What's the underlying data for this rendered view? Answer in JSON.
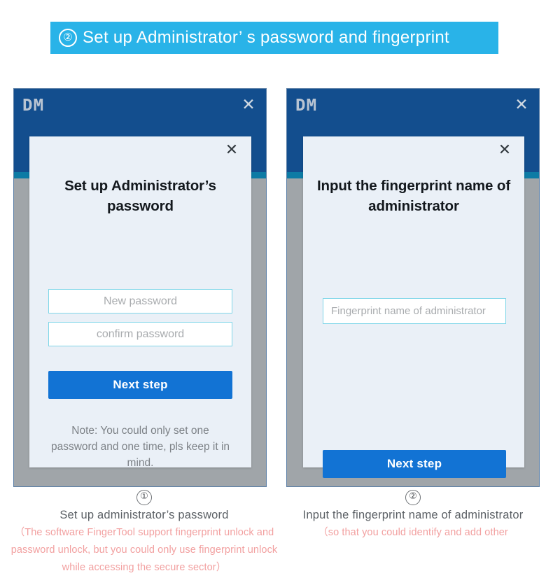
{
  "banner": {
    "number": "②",
    "text": "Set up  Administrator’  s  password and fingerprint",
    "bg_color": "#29b3e8"
  },
  "windows": [
    {
      "id": "password-window",
      "logo": "DM",
      "titlebar_close": "✕",
      "titlebar_color": "#134e8e",
      "accent_color": "#0d7ba5",
      "dialog": {
        "close": "✕",
        "title": "Set up  Administrator’s password",
        "fields": [
          {
            "name": "new-password",
            "placeholder": "New password",
            "value": ""
          },
          {
            "name": "confirm-password",
            "placeholder": "confirm password",
            "value": ""
          }
        ],
        "button": "Next step",
        "button_color": "#1273d4",
        "note": "Note: You could only set one password and one time, pls keep it in mind."
      }
    },
    {
      "id": "fingerprint-window",
      "logo": "DM",
      "titlebar_close": "✕",
      "titlebar_color": "#134e8e",
      "accent_color": "#0d7ba5",
      "dialog": {
        "close": "✕",
        "title": "Input the fingerprint name of administrator",
        "fields": [
          {
            "name": "fingerprint-name",
            "placeholder": "Fingerprint name of administrator",
            "value": ""
          }
        ],
        "button": "Next step",
        "button_color": "#1273d4",
        "note": ""
      }
    }
  ],
  "captions": [
    {
      "number": "①",
      "title": "Set up  administrator’s  password",
      "sub": "（The software FingerTool support fingerprint unlock and password unlock, but you could only use fingerprint unlock while accessing the secure sector）",
      "sub_color": "#f2a0a0"
    },
    {
      "number": "②",
      "title": "Input the  fingerprint name of administrator",
      "sub": "（so that you could identify and add other",
      "sub_color": "#f2a0a0"
    }
  ]
}
